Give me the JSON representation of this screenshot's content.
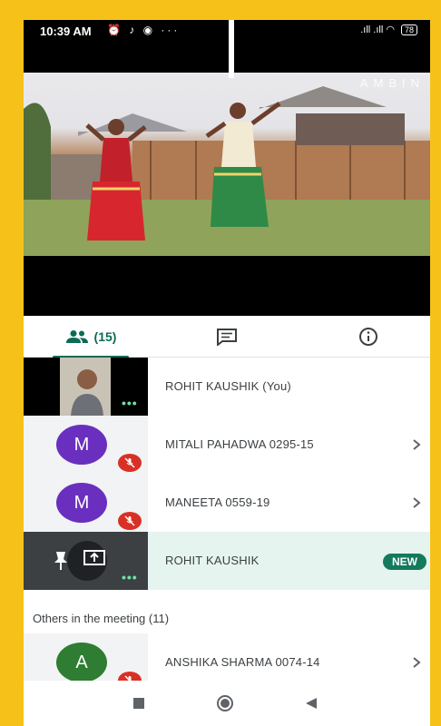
{
  "statusbar": {
    "time": "10:39 AM",
    "left_icons": "⏰ ♪ ◉ ···",
    "signal": ".ıll .ıll",
    "battery": "78"
  },
  "video": {
    "watermark": "AMBIN"
  },
  "tabs": [
    {
      "label": "(15)",
      "icon": "people-icon",
      "active": true
    },
    {
      "label": "",
      "icon": "chat-icon",
      "active": false
    },
    {
      "label": "",
      "icon": "info-icon",
      "active": false
    }
  ],
  "participants": [
    {
      "name": "ROHIT KAUSHIK (You)"
    },
    {
      "name": "MITALI PAHADWA 0295-15",
      "initial": "M",
      "avatar_color": "#6a2fbf"
    },
    {
      "name": "MANEETA 0559-19",
      "initial": "M",
      "avatar_color": "#6a2fbf"
    },
    {
      "name": "ROHIT KAUSHIK",
      "badge": "NEW"
    }
  ],
  "others": {
    "title": "Others in the meeting (11)",
    "items": [
      {
        "name": "ANSHIKA SHARMA 0074-14",
        "initial": "A",
        "avatar_color": "#2e7d32"
      }
    ]
  },
  "colors": {
    "accent": "#0b6b55",
    "mute_red": "#d93025",
    "frame_yellow": "#f6c21a"
  }
}
